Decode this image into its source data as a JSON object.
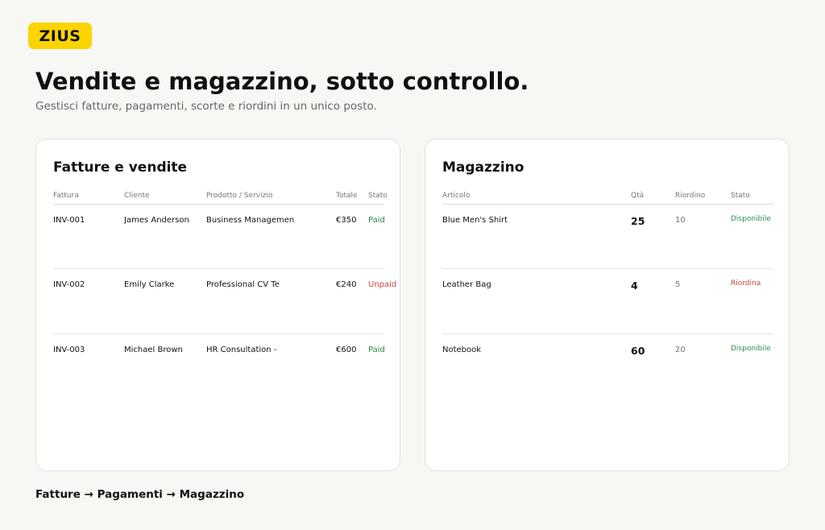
{
  "brand": {
    "logo_text": "ZIUS",
    "accent": "#fcd400"
  },
  "hero": {
    "headline": "Vendite e magazzino, sotto controllo.",
    "subline": "Gestisci fatture, pagamenti, scorte e riordini in un unico posto."
  },
  "colors": {
    "ok": "#2e8b4e",
    "alert": "#c9453c",
    "muted": "#777777"
  },
  "invoices": {
    "title": "Fatture e vendite",
    "columns": [
      "Fattura",
      "Cliente",
      "Prodotto / Servizio",
      "Totale",
      "Stato"
    ],
    "rows": [
      {
        "id": "INV-001",
        "client": "James Anderson",
        "product": "Business Managemen",
        "total": "€350",
        "status": "Paid",
        "ok": true
      },
      {
        "id": "INV-002",
        "client": "Emily Clarke",
        "product": "Professional CV Te",
        "total": "€240",
        "status": "Unpaid",
        "ok": false
      },
      {
        "id": "INV-003",
        "client": "Michael Brown",
        "product": "HR Consultation -",
        "total": "€600",
        "status": "Paid",
        "ok": true
      }
    ]
  },
  "inventory": {
    "title": "Magazzino",
    "columns": [
      "Articolo",
      "Qtà",
      "Riordino",
      "Stato"
    ],
    "rows": [
      {
        "item": "Blue Men's Shirt",
        "qty": "25",
        "reorder": "10",
        "status": "Disponibile",
        "ok": true
      },
      {
        "item": "Leather Bag",
        "qty": "4",
        "reorder": "5",
        "status": "Riordina",
        "ok": false
      },
      {
        "item": "Notebook",
        "qty": "60",
        "reorder": "20",
        "status": "Disponibile",
        "ok": true
      }
    ]
  },
  "footer": {
    "flow": "Fatture → Pagamenti → Magazzino"
  }
}
